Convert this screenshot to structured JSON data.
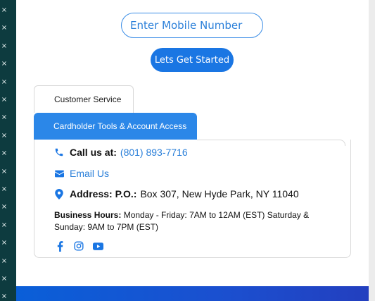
{
  "signup": {
    "mobile_placeholder": "Enter Mobile Number",
    "start_button": "Lets Get Started"
  },
  "tabs": [
    {
      "label": "Customer Service",
      "active": false
    },
    {
      "label": "Cardholder Tools & Account Access",
      "active": true
    }
  ],
  "contact": {
    "call_label": "Call us at:",
    "phone": "(801) 893-7716",
    "email_label": "Email Us",
    "address_label": "Address: P.O.:",
    "address": "Box 307, New Hyde Park, NY 11040",
    "hours_label": "Business Hours:",
    "hours": "Monday - Friday: 7AM to 12AM (EST) Saturday & Sunday: 9AM to 7PM (EST)"
  },
  "social_icons": [
    "facebook-icon",
    "instagram-icon",
    "youtube-icon"
  ],
  "colors": {
    "accent": "#1a76e3",
    "tab_active": "#2b87e8",
    "link": "#2a7fd9",
    "left_strip": "#0d3b3f",
    "bottom_band": "#0a5fd8"
  }
}
